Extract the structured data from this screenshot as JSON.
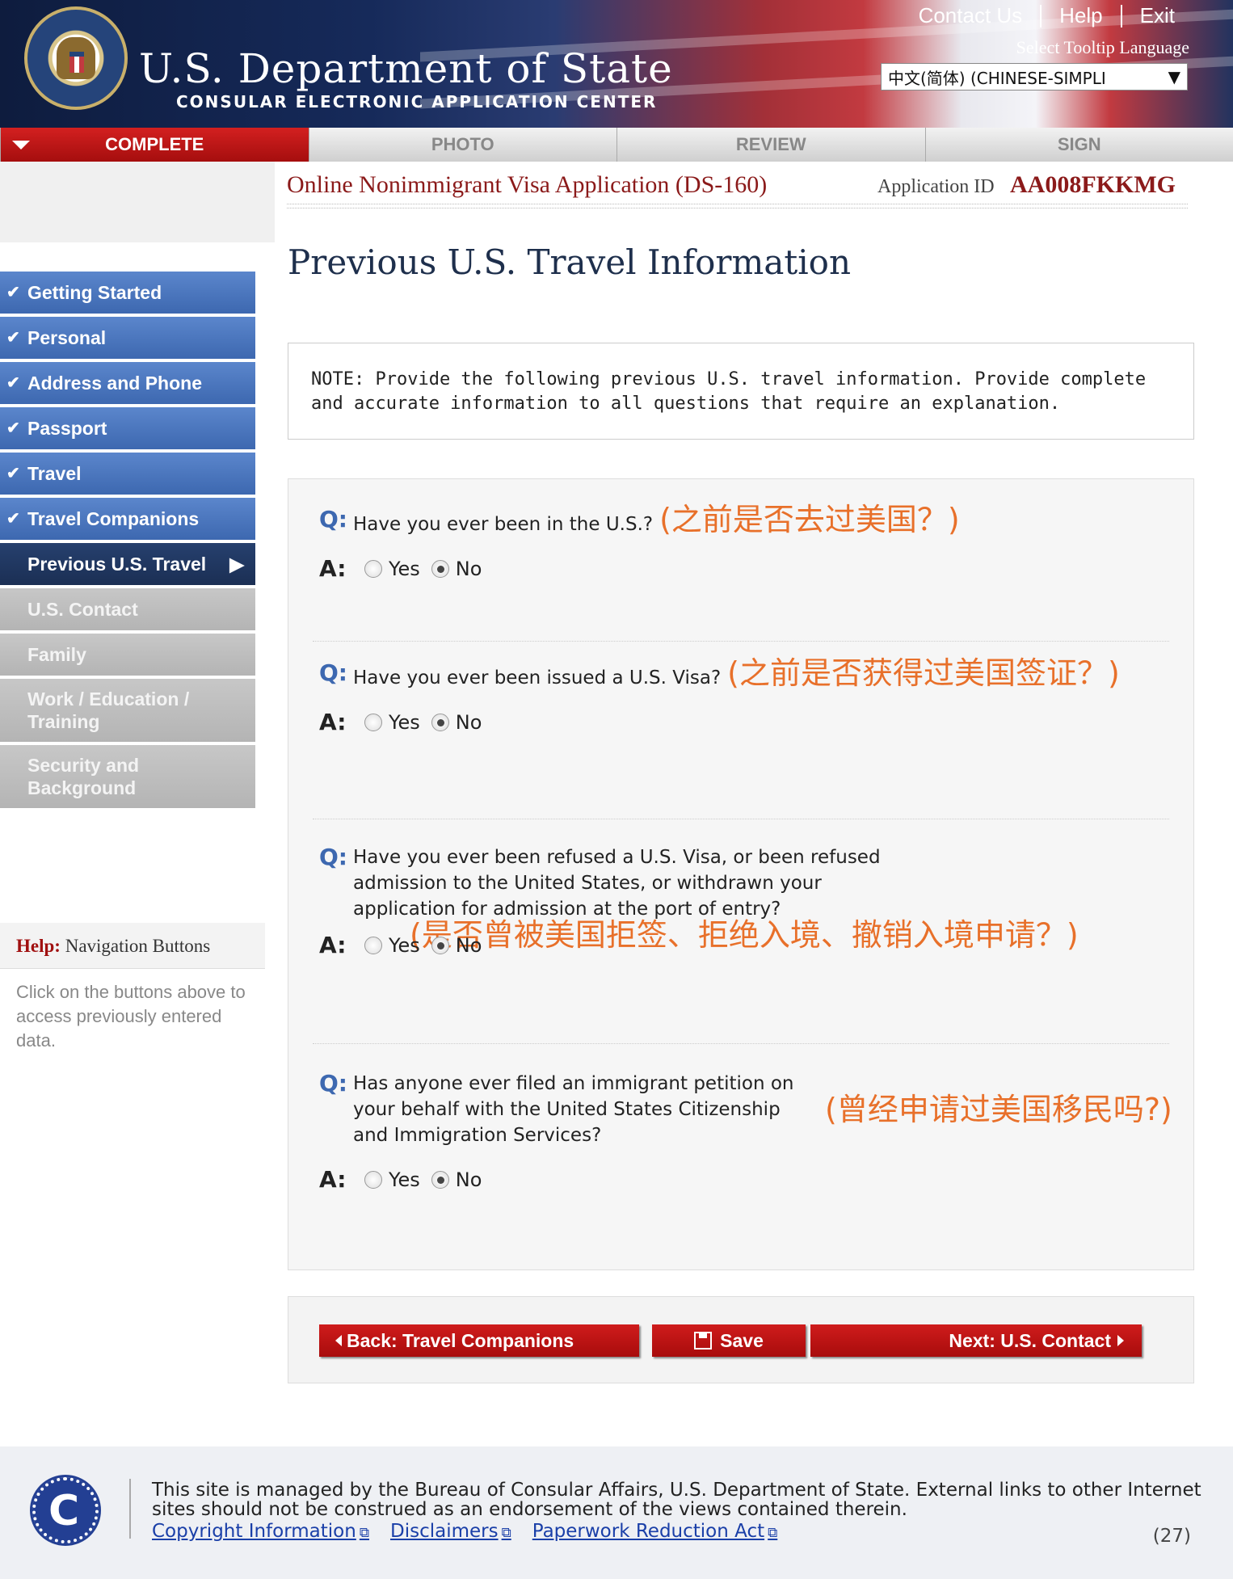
{
  "header": {
    "links": [
      "Contact Us",
      "Help",
      "Exit"
    ],
    "dept_title": "U.S. Department of State",
    "dept_sub": "CONSULAR ELECTRONIC APPLICATION CENTER",
    "tooltip_label": "Select Tooltip Language",
    "language_value": "中文(简体) (CHINESE-SIMPLI"
  },
  "progress": {
    "steps": [
      "COMPLETE",
      "PHOTO",
      "REVIEW",
      "SIGN"
    ],
    "active": "COMPLETE"
  },
  "app": {
    "title": "Online Nonimmigrant Visa Application (DS-160)",
    "id_label": "Application ID",
    "id_value": "AA008FKKMG"
  },
  "sidebar": {
    "items": [
      {
        "label": "Getting Started",
        "state": "done"
      },
      {
        "label": "Personal",
        "state": "done"
      },
      {
        "label": "Address and Phone",
        "state": "done"
      },
      {
        "label": "Passport",
        "state": "done"
      },
      {
        "label": "Travel",
        "state": "done"
      },
      {
        "label": "Travel Companions",
        "state": "done"
      },
      {
        "label": "Previous U.S. Travel",
        "state": "current"
      },
      {
        "label": "U.S. Contact",
        "state": "pending"
      },
      {
        "label": "Family",
        "state": "pending"
      },
      {
        "label": "Work / Education / Training",
        "state": "pending"
      },
      {
        "label": "Security and Background",
        "state": "pending"
      }
    ],
    "help_title_bold": "Help:",
    "help_title_rest": " Navigation Buttons",
    "help_text": "Click on the buttons above to access previously entered data."
  },
  "main": {
    "page_title": "Previous U.S. Travel Information",
    "note": "NOTE: Provide the following previous U.S. travel information. Provide complete and accurate information to all questions that require an explanation.",
    "q_label": "Q:",
    "a_label": "A:",
    "yes_label": "Yes",
    "no_label": "No",
    "questions": [
      {
        "text": "Have you ever been in the U.S.?",
        "annotation": "(之前是否去过美国？)",
        "answer": "No"
      },
      {
        "text": "Have you ever been issued a U.S. Visa?",
        "annotation": "(之前是否获得过美国签证？)",
        "answer": "No"
      },
      {
        "text": "Have you ever been refused a U.S. Visa, or been refused admission to the United States, or withdrawn your application for admission at the port of entry?",
        "annotation": "(是否曾被美国拒签、拒绝入境、撤销入境申请？)",
        "answer": "No"
      },
      {
        "text": "Has anyone ever filed an immigrant petition on your behalf with the United States Citizenship and Immigration Services?",
        "annotation": "(曾经申请过美国移民吗?)",
        "answer": "No"
      }
    ]
  },
  "nav_buttons": {
    "back": "Back: Travel Companions",
    "save": "Save",
    "next": "Next: U.S. Contact"
  },
  "footer": {
    "text": "This site is managed by the Bureau of Consular Affairs, U.S. Department of State. External links to other Internet sites should not be construed as an endorsement of the views contained therein.",
    "links": [
      "Copyright Information",
      "Disclaimers",
      "Paperwork Reduction Act"
    ],
    "page_num": "(27)"
  }
}
